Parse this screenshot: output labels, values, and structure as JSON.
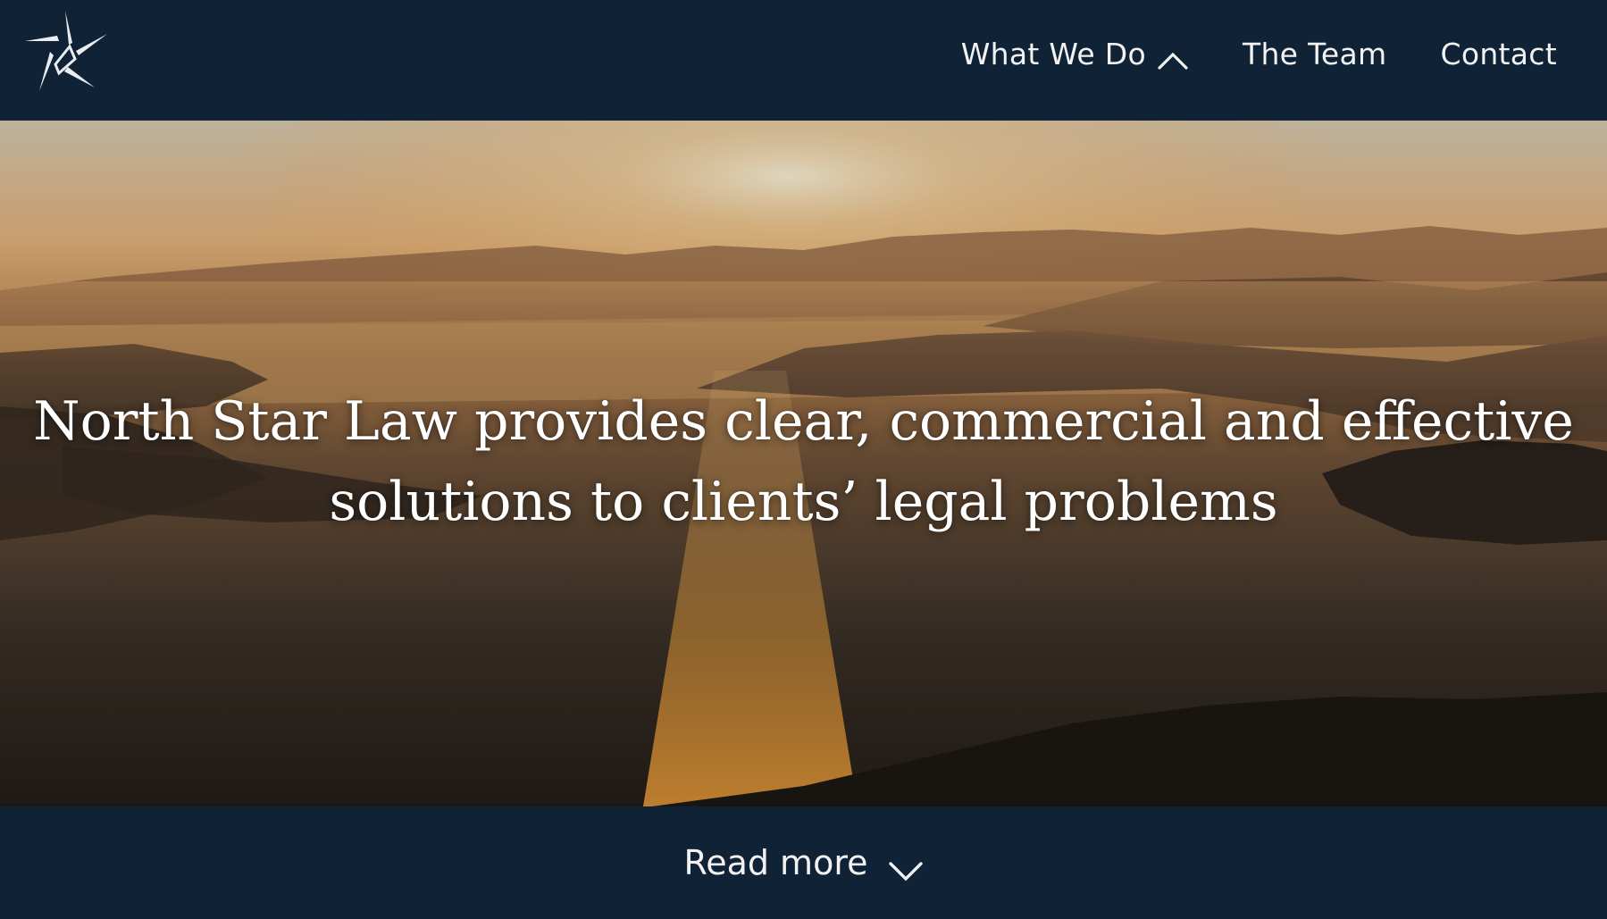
{
  "nav": {
    "items": [
      {
        "label": "What We Do",
        "icon": "chevron-up-icon"
      },
      {
        "label": "The Team"
      },
      {
        "label": "Contact"
      }
    ]
  },
  "hero": {
    "line1": "North Star Law provides clear, commercial and effective",
    "line2": "solutions to clients’ legal problems"
  },
  "footer": {
    "read_more_label": "Read more",
    "icon": "chevron-down-icon"
  },
  "colors": {
    "navy": "#102236",
    "text": "#f2f2f2"
  }
}
